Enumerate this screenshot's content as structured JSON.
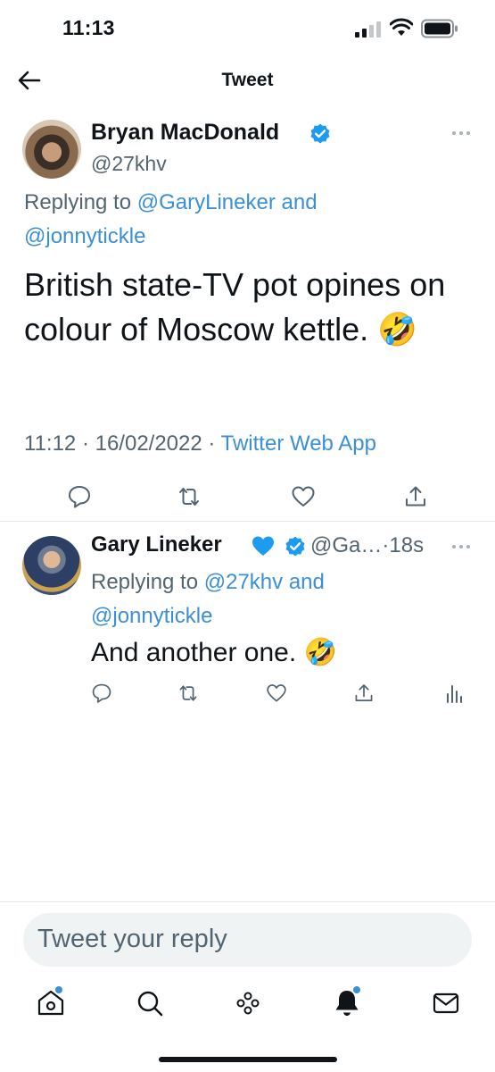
{
  "status_bar": {
    "time": "11:13"
  },
  "nav": {
    "title": "Tweet"
  },
  "main_tweet": {
    "author_name": "Bryan MacDonald",
    "author_handle": "@27khv",
    "replying_prefix": "Replying to ",
    "replying_user1": "@GaryLineker",
    "replying_and": " and",
    "replying_user2": "@jonnytickle",
    "text": "British state-TV pot opines on colour of Moscow kettle. 🤣",
    "time": "11:12",
    "date": "16/02/2022",
    "source": "Twitter Web App"
  },
  "reply_tweet": {
    "author_name": "Gary Lineker",
    "author_handle": "@Ga…",
    "age": "·18s",
    "replying_prefix": "Replying to ",
    "replying_user1": "@27khv",
    "replying_and": " and",
    "replying_user2": "@jonnytickle",
    "text": "And another one. 🤣"
  },
  "composer": {
    "placeholder": "Tweet your reply"
  },
  "meta_separator": " · ",
  "colors": {
    "accent": "#3b8fd6",
    "secondary_text": "#536471",
    "verified": "#1d9bf0",
    "heart_blue": "#1d9bf0"
  },
  "icons": {
    "actions": [
      "reply-icon",
      "retweet-icon",
      "like-icon",
      "share-icon",
      "analytics-icon"
    ],
    "tabs": [
      "home-icon",
      "search-icon",
      "spaces-icon",
      "notifications-icon",
      "messages-icon"
    ]
  }
}
